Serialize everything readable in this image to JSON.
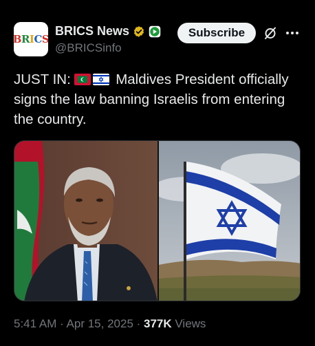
{
  "author": {
    "avatar_text": [
      "B",
      "R",
      "I",
      "C",
      "S"
    ],
    "display_name": "BRICS News",
    "handle": "@BRICSinfo",
    "verified_badge_color": "#e2b719",
    "affiliate_badge_color": "#1d9b3a"
  },
  "actions": {
    "subscribe_label": "Subscribe",
    "grok_icon": "slashed-circle-icon",
    "more_icon": "more-dots-icon"
  },
  "post": {
    "prefix": "JUST IN:",
    "flags": [
      "maldives-flag",
      "israel-flag"
    ],
    "body": "Maldives President officially signs the law banning Israelis from entering the country."
  },
  "media": {
    "left": "photo-of-maldives-president-with-flag",
    "right": "photo-of-israeli-flag"
  },
  "meta": {
    "time": "5:41 AM",
    "sep1": " · ",
    "date": "Apr 15, 2025",
    "sep2": " · ",
    "views_count": "377K",
    "views_label": " Views"
  },
  "colors": {
    "background": "#000000",
    "text": "#e7e9ea",
    "muted": "#71767b"
  }
}
